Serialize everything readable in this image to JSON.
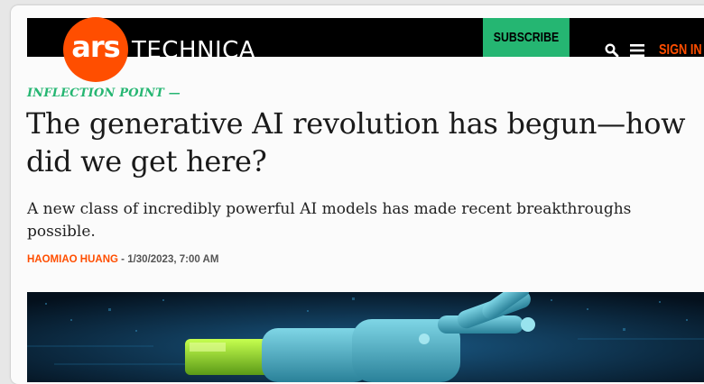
{
  "header": {
    "logo_primary": "ars",
    "logo_secondary": "TECHNICA",
    "subscribe_label": "SUBSCRIBE",
    "signin_label": "SIGN IN",
    "search_icon": "search-icon",
    "menu_icon": "hamburger-menu-icon"
  },
  "article": {
    "kicker": "INFLECTION POINT —",
    "title": "The generative AI revolution has begun—how did we get here?",
    "subtitle": "A new class of incredibly powerful AI models has made recent breakthroughs possible.",
    "author": "HAOMIAO HUANG",
    "separator": " - ",
    "date": "1/30/2023, 7:00 AM"
  },
  "colors": {
    "brand_orange": "#ff4e00",
    "accent_green": "#25b672",
    "masthead_black": "#000000"
  }
}
